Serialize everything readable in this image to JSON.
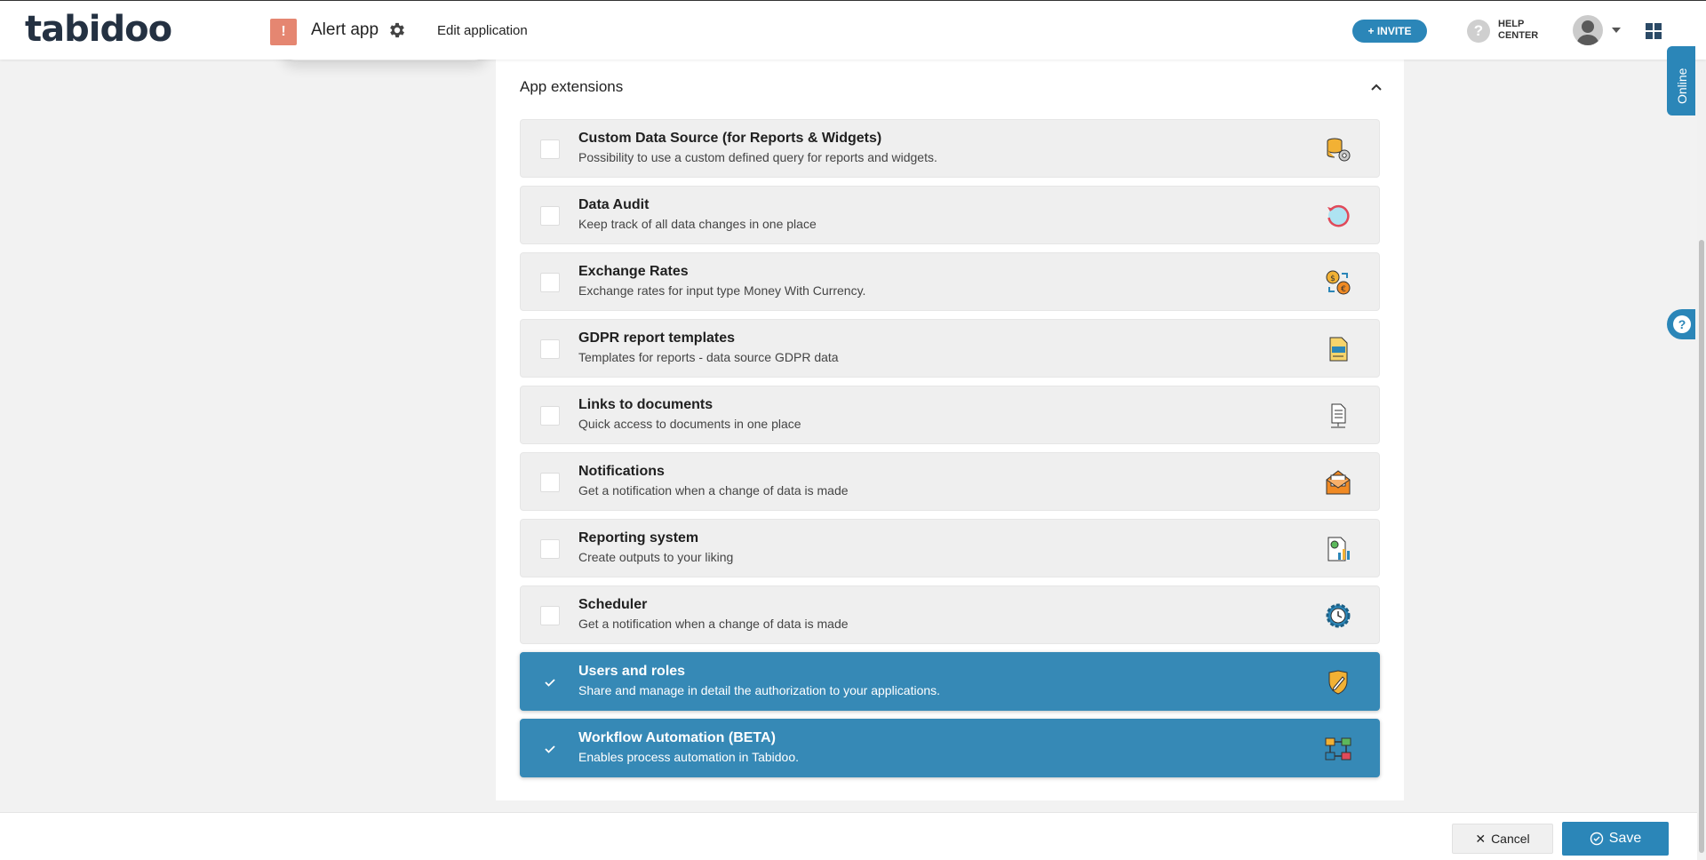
{
  "header": {
    "logo_text": "tabidoo",
    "app_badge": "!",
    "app_name": "Alert app",
    "edit_link": "Edit application",
    "invite_label": "+ INVITE",
    "help_label_1": "HELP",
    "help_label_2": "CENTER"
  },
  "side_tabs": {
    "online_label": "Online",
    "help_float": "?"
  },
  "section": {
    "title": "App extensions"
  },
  "extensions": [
    {
      "name": "Custom Data Source (for Reports & Widgets)",
      "desc": "Possibility to use a custom defined query for reports and widgets.",
      "checked": false,
      "icon": "database-gear-icon"
    },
    {
      "name": "Data Audit",
      "desc": "Keep track of all data changes in one place",
      "checked": false,
      "icon": "audit-history-icon"
    },
    {
      "name": "Exchange Rates",
      "desc": "Exchange rates for input type Money With Currency.",
      "checked": false,
      "icon": "currency-exchange-icon"
    },
    {
      "name": "GDPR report templates",
      "desc": "Templates for reports - data source GDPR data",
      "checked": false,
      "icon": "gdpr-document-icon"
    },
    {
      "name": "Links to documents",
      "desc": "Quick access to documents in one place",
      "checked": false,
      "icon": "document-link-icon"
    },
    {
      "name": "Notifications",
      "desc": "Get a notification when a change of data is made",
      "checked": false,
      "icon": "envelope-bell-icon"
    },
    {
      "name": "Reporting system",
      "desc": "Create outputs to your liking",
      "checked": false,
      "icon": "report-chart-icon"
    },
    {
      "name": "Scheduler",
      "desc": "Get a notification when a change of data is made",
      "checked": false,
      "icon": "gear-clock-icon"
    },
    {
      "name": "Users and roles",
      "desc": "Share and manage in detail the authorization to your applications.",
      "checked": true,
      "icon": "shield-pencil-icon"
    },
    {
      "name": "Workflow Automation (BETA)",
      "desc": "Enables process automation in Tabidoo.",
      "checked": true,
      "icon": "workflow-icon"
    }
  ],
  "footer": {
    "cancel_label": "Cancel",
    "save_label": "Save"
  },
  "colors": {
    "accent": "#2b86b8",
    "selected_row": "#3689b6",
    "app_badge": "#e58671",
    "row_bg": "#efefef"
  }
}
